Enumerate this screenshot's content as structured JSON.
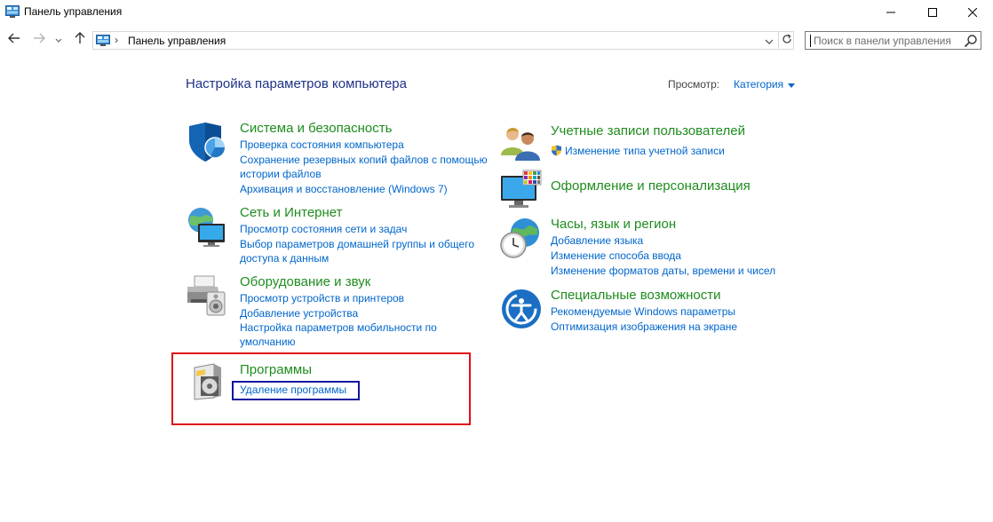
{
  "window": {
    "title": "Панель управления"
  },
  "address_bar": {
    "crumb": "Панель управления",
    "separator": "›"
  },
  "search": {
    "placeholder": "Поиск в панели управления"
  },
  "content": {
    "heading": "Настройка параметров компьютера",
    "view_label": "Просмотр:",
    "view_value": "Категория"
  },
  "categories": {
    "system": {
      "title": "Система и безопасность",
      "links": [
        "Проверка состояния компьютера",
        "Сохранение резервных копий файлов с помощью",
        "истории файлов",
        "Архивация и восстановление (Windows 7)"
      ]
    },
    "network": {
      "title": "Сеть и Интернет",
      "links": [
        "Просмотр состояния сети и задач",
        "Выбор параметров домашней группы и общего",
        "доступа к данным"
      ]
    },
    "hardware": {
      "title": "Оборудование и звук",
      "links": [
        "Просмотр устройств и принтеров",
        "Добавление устройства",
        "Настройка параметров мобильности по",
        "умолчанию"
      ]
    },
    "programs": {
      "title": "Программы",
      "links": [
        "Удаление программы"
      ]
    },
    "accounts": {
      "title": "Учетные записи пользователей",
      "links": [
        "Изменение типа учетной записи"
      ]
    },
    "appearance": {
      "title": "Оформление и персонализация",
      "links": []
    },
    "clock": {
      "title": "Часы, язык и регион",
      "links": [
        "Добавление языка",
        "Изменение способа ввода",
        "Изменение форматов даты, времени и чисел"
      ]
    },
    "access": {
      "title": "Специальные возможности",
      "links": [
        "Рекомендуемые Windows параметры",
        "Оптимизация изображения на экране"
      ]
    }
  },
  "icons": {
    "app": "control-panel-icon",
    "minimize": "minimize-icon",
    "maximize": "maximize-icon",
    "close": "close-icon",
    "back": "back-arrow-icon",
    "forward": "forward-arrow-icon",
    "recent": "chevron-down-icon",
    "up": "up-arrow-icon",
    "refresh": "refresh-icon",
    "search": "search-icon"
  },
  "colors": {
    "heading": "#1e3287",
    "category_title": "#1e8c1e",
    "link": "#0066cc",
    "highlight_red": "#e0101a",
    "highlight_blue": "#1414a0"
  }
}
